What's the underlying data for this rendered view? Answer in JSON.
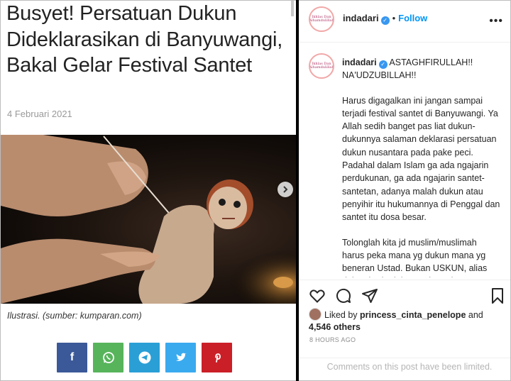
{
  "article": {
    "title": "Busyet! Persatuan Dukun Dideklarasikan di Banyuwangi, Bakal Gelar Festival Santet",
    "date": "4 Februari 2021",
    "caption": "Ilustrasi. (sumber: kumparan.com)"
  },
  "share": {
    "buttons": [
      {
        "icon": "facebook-icon",
        "label": "f",
        "color": "#3b5998"
      },
      {
        "icon": "whatsapp-icon",
        "label": "",
        "color": "#57b45b"
      },
      {
        "icon": "telegram-icon",
        "label": "",
        "color": "#2a9fd6"
      },
      {
        "icon": "twitter-icon",
        "label": "",
        "color": "#3aaaef"
      },
      {
        "icon": "pinterest-icon",
        "label": "",
        "color": "#cb1f27"
      }
    ]
  },
  "post": {
    "username": "indadari",
    "follow_label": "Follow",
    "avatar_text": "Ikhlas Dan Alhamdulillah",
    "comment": {
      "username": "indadari",
      "headline": "ASTAGHFIRULLAH!! NA'UDZUBILLAH!!",
      "paragraph1": "Harus digagalkan ini jangan sampai terjadi festival santet di Banyuwangi. Ya Allah sedih banget pas liat dukun-dukunnya salaman deklarasi persatuan dukun nusantara pada pake peci. Padahal dalam Islam ga ada ngajarin perdukunan, ga ada ngajarin santet-santetan, adanya malah dukun atau penyihir itu hukumannya di Penggal dan santet itu dosa besar.",
      "paragraph2": "Tolonglah kita jd muslim/muslimah harus peka mana yg dukun mana yg beneran Ustad. Bukan USKUN, alias dukun berkedok Ustadz. Pake pengobatan yg mengandung"
    },
    "liked_by_prefix": "Liked by ",
    "liked_by_user": "princess_cinta_penelope",
    "liked_by_and": " and",
    "others": "4,546 others",
    "timestamp": "8 HOURS AGO",
    "comments_limited": "Comments on this post have been limited."
  },
  "colors": {
    "instagram_blue": "#0095f6",
    "text_dark": "#262626",
    "muted": "#8e8e8e"
  }
}
